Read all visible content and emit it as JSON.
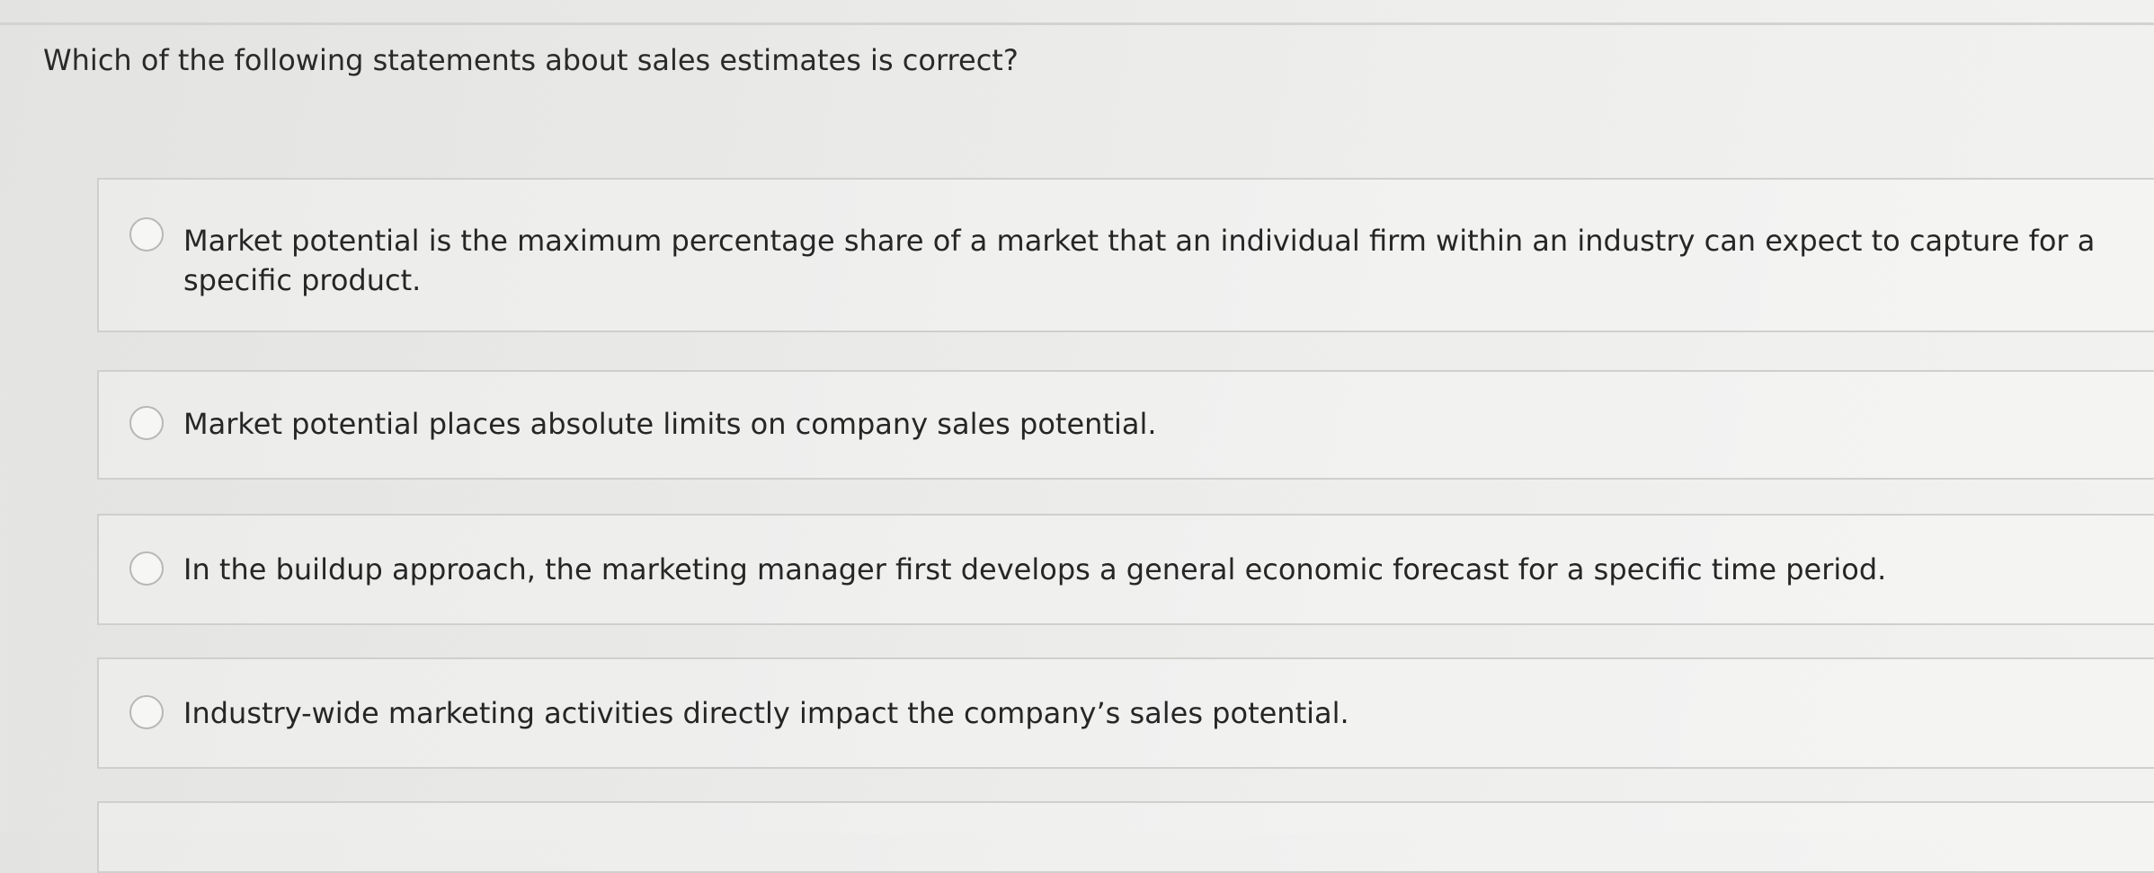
{
  "question": {
    "text": "Which of the following statements about sales estimates is correct?"
  },
  "options": [
    {
      "label": "Market potential is the maximum percentage share of a market that an individual firm within an industry can expect to capture for a specific product.",
      "selected": false
    },
    {
      "label": "Market potential places absolute limits on company sales potential.",
      "selected": false
    },
    {
      "label": "In the buildup approach, the marketing manager first develops a general economic forecast for a specific time period.",
      "selected": false
    },
    {
      "label": "Industry-wide marketing activities directly impact the company’s sales potential.",
      "selected": false
    }
  ]
}
